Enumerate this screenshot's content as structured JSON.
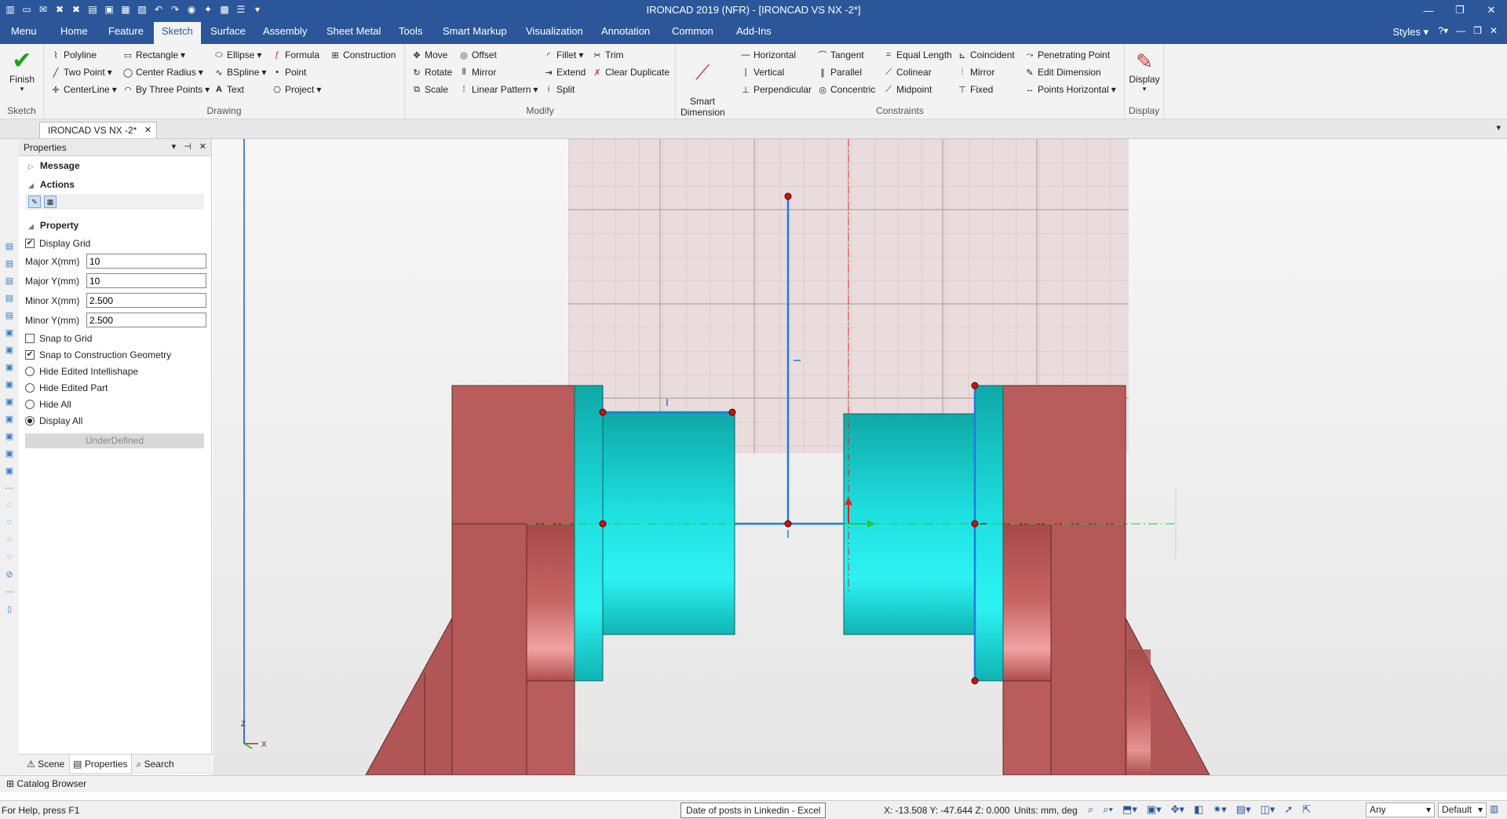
{
  "window": {
    "title": "IRONCAD 2019 (NFR) - [IRONCAD VS NX -2*]"
  },
  "menu_tabs": [
    "Menu",
    "Home",
    "Feature",
    "Sketch",
    "Surface",
    "Assembly",
    "Sheet Metal",
    "Tools",
    "Smart Markup",
    "Visualization",
    "Annotation",
    "Common",
    "Add-Ins"
  ],
  "active_tab": "Sketch",
  "styles_label": "Styles",
  "ribbon": {
    "sketch_group": {
      "label": "Sketch",
      "finish": "Finish"
    },
    "drawing_group": {
      "label": "Drawing",
      "items": [
        "Polyline",
        "Two Point",
        "CenterLine",
        "Rectangle",
        "Center Radius",
        "By Three Points",
        "Ellipse",
        "BSpline",
        "Text",
        "Formula",
        "Point",
        "Project",
        "Construction"
      ]
    },
    "modify_group": {
      "label": "Modify",
      "items": [
        "Move",
        "Rotate",
        "Scale",
        "Offset",
        "Mirror",
        "Linear Pattern",
        "Fillet",
        "Extend",
        "Split",
        "Trim",
        "Clear Duplicate"
      ]
    },
    "constraints_group": {
      "label": "Constraints",
      "smart_dimension": "Smart\nDimension",
      "items": [
        "Horizontal",
        "Vertical",
        "Perpendicular",
        "Tangent",
        "Parallel",
        "Concentric",
        "Equal Length",
        "Colinear",
        "Midpoint",
        "Coincident",
        "Mirror",
        "Fixed",
        "Penetrating Point",
        "Edit Dimension",
        "Points Horizontal"
      ]
    },
    "display_group": {
      "label": "Display",
      "display": "Display"
    }
  },
  "document_tab": "IRONCAD VS NX -2*",
  "properties": {
    "header": "Properties",
    "message": "Message",
    "actions": "Actions",
    "property": "Property",
    "display_grid": "Display Grid",
    "fields": [
      {
        "label": "Major X(mm)",
        "value": "10"
      },
      {
        "label": "Major Y(mm)",
        "value": "10"
      },
      {
        "label": "Minor X(mm)",
        "value": "2.500"
      },
      {
        "label": "Minor Y(mm)",
        "value": "2.500"
      }
    ],
    "snap_to_grid": "Snap to Grid",
    "snap_to_construction": "Snap to Construction Geometry",
    "radios": [
      "Hide Edited Intellishape",
      "Hide Edited Part",
      "Hide All",
      "Display All"
    ],
    "selected_radio": "Display All",
    "status": "UnderDefined"
  },
  "bottom_tabs": [
    "Scene",
    "Properties",
    "Search"
  ],
  "catalog_browser": "Catalog Browser",
  "status": {
    "help": "For Help, press F1",
    "tooltip": "Date of posts in Linkedin - Excel",
    "coords": "X: -13.508 Y: -47.644 Z: 0.000",
    "units": "Units: mm, deg",
    "filter": "Any",
    "style": "Default"
  },
  "colors": {
    "accent": "#2b579a",
    "part_red": "#b85c5c",
    "cylinder_cyan": "#14c6c6",
    "sketch_line": "#1e7be0",
    "point_red": "#d01010"
  }
}
